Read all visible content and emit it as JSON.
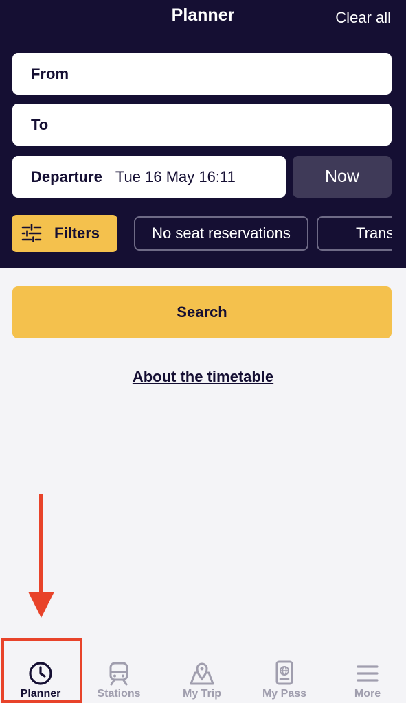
{
  "header": {
    "title": "Planner",
    "clear_all": "Clear all"
  },
  "form": {
    "from_label": "From",
    "to_label": "To",
    "departure_label": "Departure",
    "departure_value": "Tue 16 May 16:11",
    "now_label": "Now"
  },
  "filters": {
    "label": "Filters",
    "chips": [
      "No seat reservations",
      "Transfers"
    ]
  },
  "search_label": "Search",
  "about_link": "About the timetable",
  "tabs": [
    {
      "label": "Planner",
      "icon": "clock-icon",
      "active": true
    },
    {
      "label": "Stations",
      "icon": "train-icon",
      "active": false
    },
    {
      "label": "My Trip",
      "icon": "map-pin-icon",
      "active": false
    },
    {
      "label": "My Pass",
      "icon": "passport-icon",
      "active": false
    },
    {
      "label": "More",
      "icon": "menu-icon",
      "active": false
    }
  ],
  "colors": {
    "header_bg": "#150f33",
    "accent_yellow": "#f4c14d",
    "now_button_bg": "#3f3a58",
    "annotation_red": "#e8432a",
    "inactive_tab": "#a09eae"
  }
}
